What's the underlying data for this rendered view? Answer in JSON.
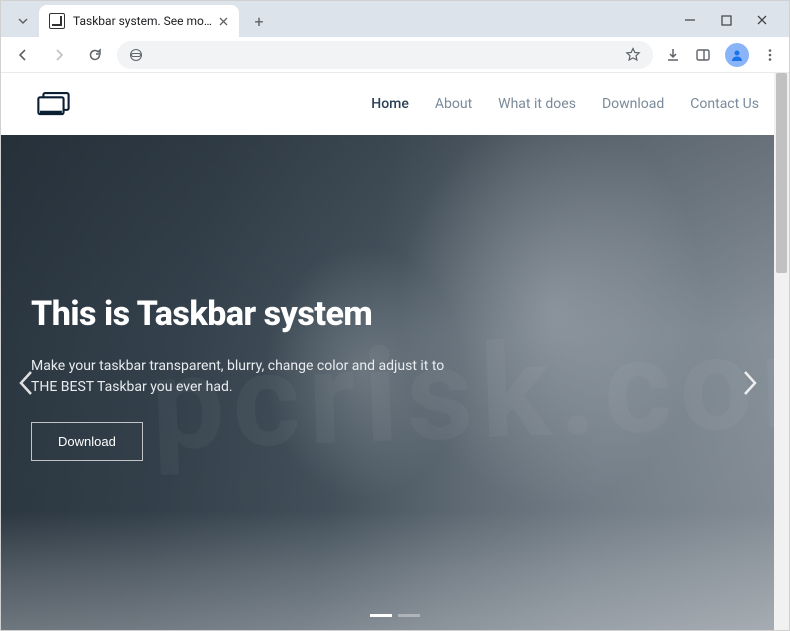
{
  "browser": {
    "tab_title": "Taskbar system. See more - do",
    "omnibox_value": ""
  },
  "header": {
    "nav": [
      {
        "label": "Home",
        "active": true
      },
      {
        "label": "About",
        "active": false
      },
      {
        "label": "What it does",
        "active": false
      },
      {
        "label": "Download",
        "active": false
      },
      {
        "label": "Contact Us",
        "active": false
      }
    ]
  },
  "hero": {
    "title": "This is Taskbar system",
    "subtitle": "Make your taskbar transparent, blurry, change color and adjust it to THE BEST Taskbar you ever had.",
    "button_label": "Download"
  }
}
